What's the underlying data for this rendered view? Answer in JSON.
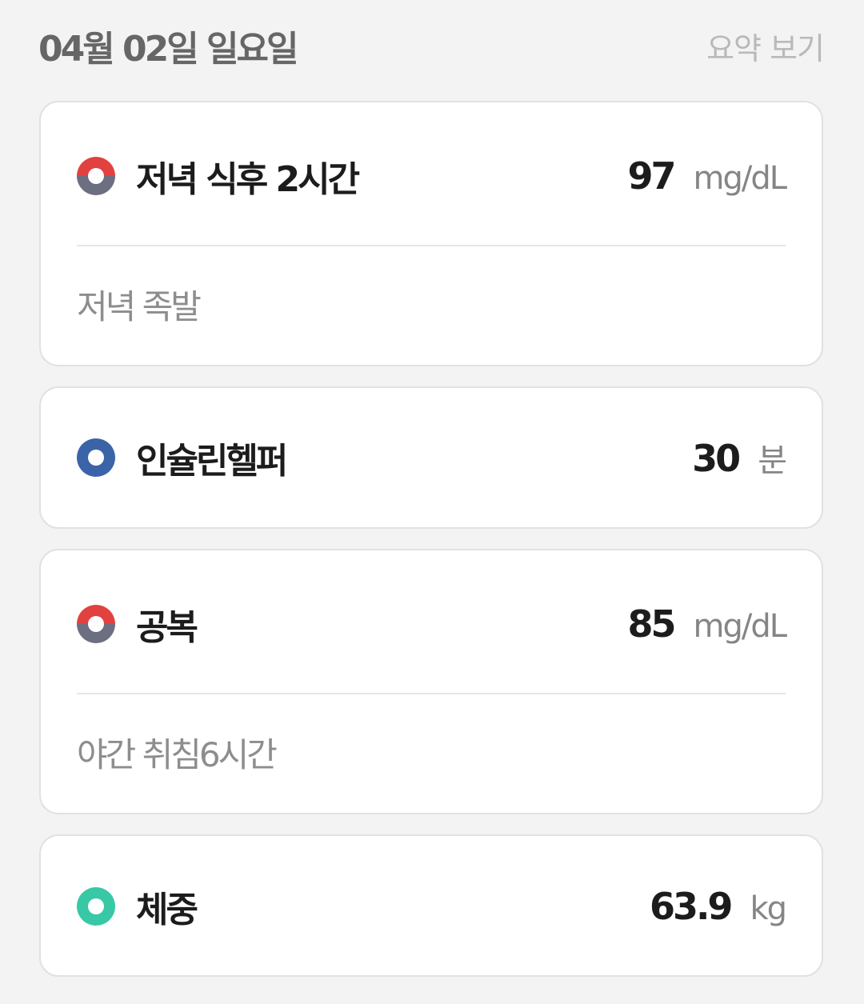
{
  "header": {
    "date": "04월 02일 일요일",
    "summary_link": "요약 보기"
  },
  "colors": {
    "glucose_top": "#e1413f",
    "glucose_bottom": "#6b6f80",
    "insulin": "#3b64a8",
    "weight": "#38c8a6"
  },
  "records": [
    {
      "title": "저녁 식후 2시간",
      "value": "97",
      "unit": "mg/dL",
      "note": "저녁 족발",
      "icon": "blood-glucose-icon"
    },
    {
      "title": "인슐린헬퍼",
      "value": "30",
      "unit": "분",
      "icon": "insulin-icon"
    },
    {
      "title": "공복",
      "value": "85",
      "unit": "mg/dL",
      "note": "야간 취침6시간",
      "icon": "blood-glucose-icon"
    },
    {
      "title": "체중",
      "value": "63.9",
      "unit": "kg",
      "icon": "weight-icon"
    }
  ]
}
